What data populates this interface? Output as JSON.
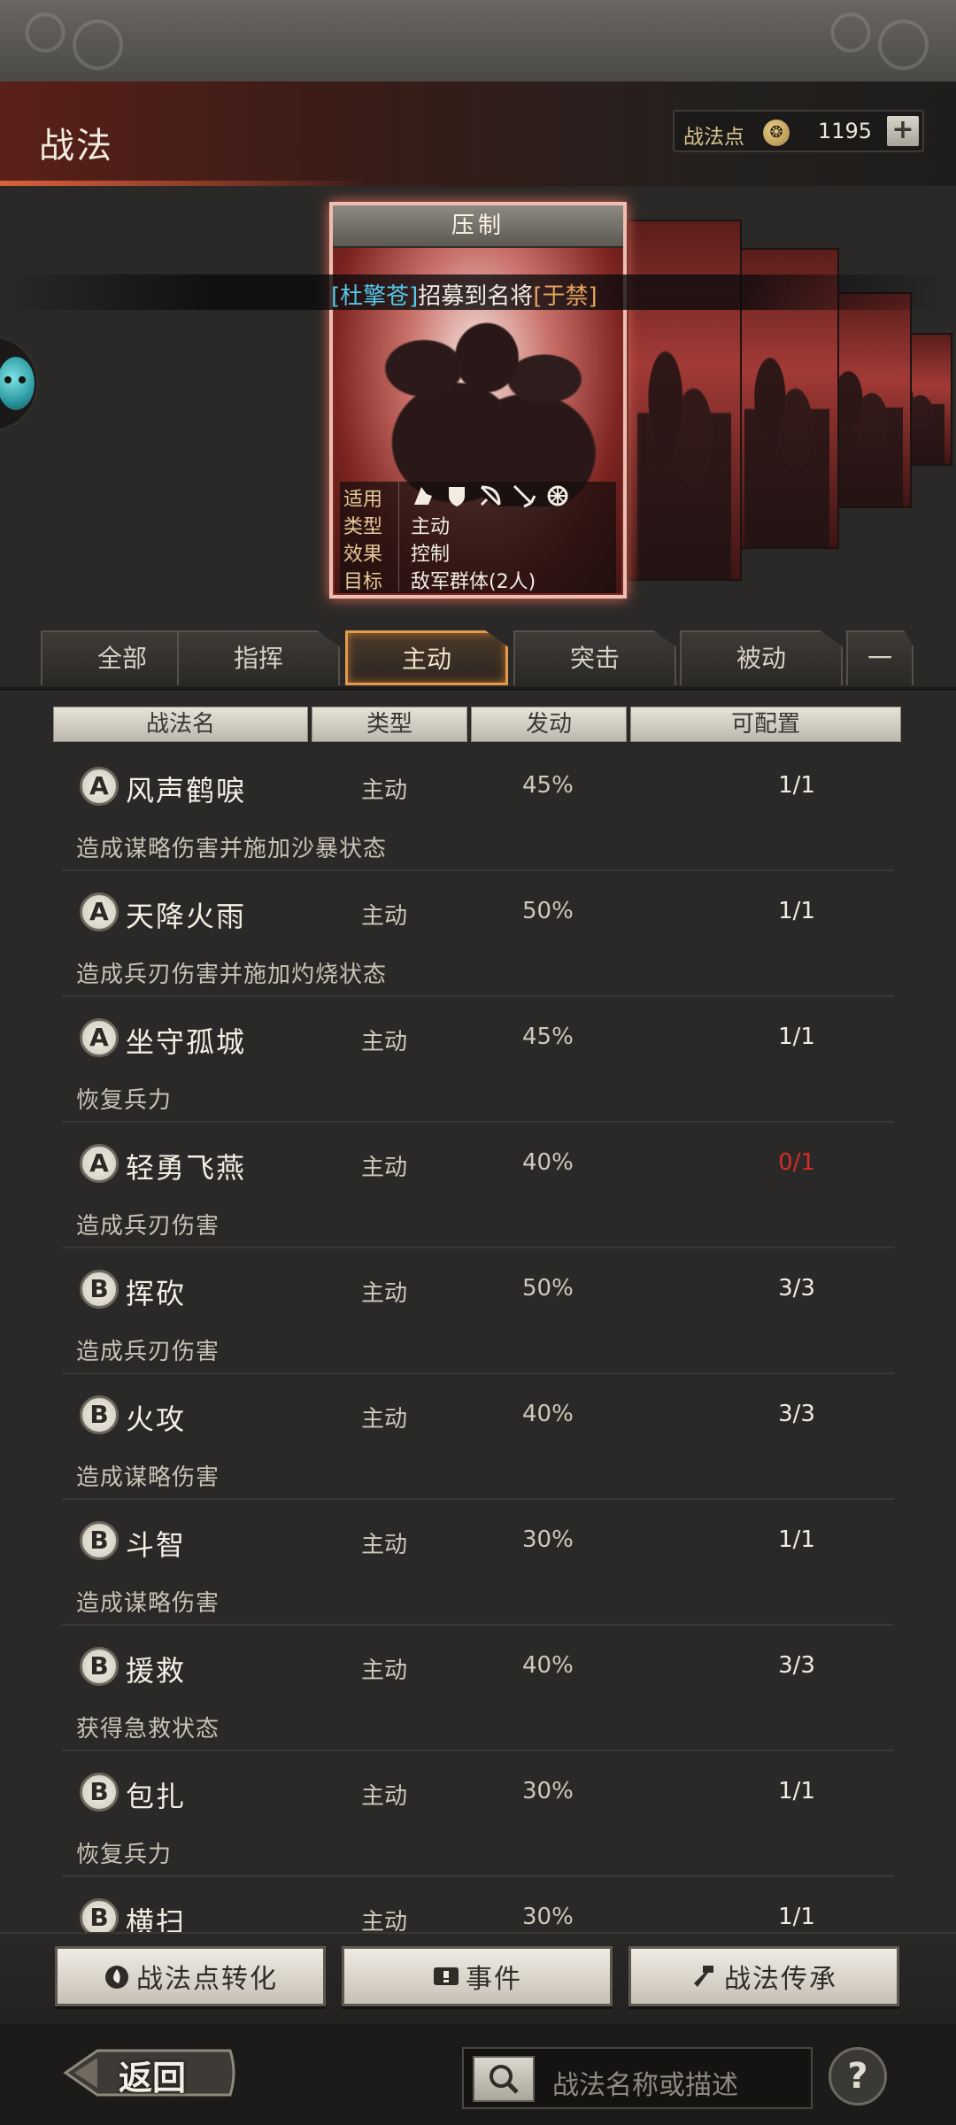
{
  "header": {
    "title": "战法",
    "points_label": "战法点",
    "points_value": "1195",
    "plus_label": "+"
  },
  "featured_card": {
    "name": "压制",
    "info": {
      "applicable_label": "适用",
      "troop_icons": [
        "cavalry-icon",
        "shield-icon",
        "bow-icon",
        "spear-icon",
        "chariot-icon"
      ],
      "type_label": "类型",
      "type_value": "主动",
      "effect_label": "效果",
      "effect_value": "控制",
      "target_label": "目标",
      "target_value": "敌军群体(2人)"
    }
  },
  "recruit_banner": {
    "player": "[杜擎苍]",
    "message": "招募到名将",
    "general": "[于禁]"
  },
  "tabs": [
    {
      "label": "全部"
    },
    {
      "label": "指挥"
    },
    {
      "label": "主动"
    },
    {
      "label": "突击"
    },
    {
      "label": "被动"
    },
    {
      "label": "一"
    }
  ],
  "columns": {
    "name": "战法名",
    "type": "类型",
    "trigger": "发动",
    "config": "可配置"
  },
  "skills": [
    {
      "grade": "A",
      "name": "风声鹤唳",
      "type": "主动",
      "rate": "45%",
      "config": "1/1",
      "desc": "造成谋略伤害并施加沙暴状态"
    },
    {
      "grade": "A",
      "name": "天降火雨",
      "type": "主动",
      "rate": "50%",
      "config": "1/1",
      "desc": "造成兵刃伤害并施加灼烧状态"
    },
    {
      "grade": "A",
      "name": "坐守孤城",
      "type": "主动",
      "rate": "45%",
      "config": "1/1",
      "desc": "恢复兵力"
    },
    {
      "grade": "A",
      "name": "轻勇飞燕",
      "type": "主动",
      "rate": "40%",
      "config": "0/1",
      "desc": "造成兵刃伤害"
    },
    {
      "grade": "B",
      "name": "挥砍",
      "type": "主动",
      "rate": "50%",
      "config": "3/3",
      "desc": "造成兵刃伤害"
    },
    {
      "grade": "B",
      "name": "火攻",
      "type": "主动",
      "rate": "40%",
      "config": "3/3",
      "desc": "造成谋略伤害"
    },
    {
      "grade": "B",
      "name": "斗智",
      "type": "主动",
      "rate": "30%",
      "config": "1/1",
      "desc": "造成谋略伤害"
    },
    {
      "grade": "B",
      "name": "援救",
      "type": "主动",
      "rate": "40%",
      "config": "3/3",
      "desc": "获得急救状态"
    },
    {
      "grade": "B",
      "name": "包扎",
      "type": "主动",
      "rate": "30%",
      "config": "1/1",
      "desc": "恢复兵力"
    },
    {
      "grade": "B",
      "name": "横扫",
      "type": "主动",
      "rate": "30%",
      "config": "1/1",
      "desc": ""
    }
  ],
  "actions": {
    "convert_label": "战法点转化",
    "events_label": "事件",
    "inherit_label": "战法传承"
  },
  "footer": {
    "back_label": "返回",
    "search_placeholder": "战法名称或描述",
    "help_label": "?"
  },
  "colors": {
    "accent_tab": "#e29a4c",
    "unavailable": "#d72b25",
    "player_name": "#54c8e8",
    "general_name": "#e4a35d"
  }
}
